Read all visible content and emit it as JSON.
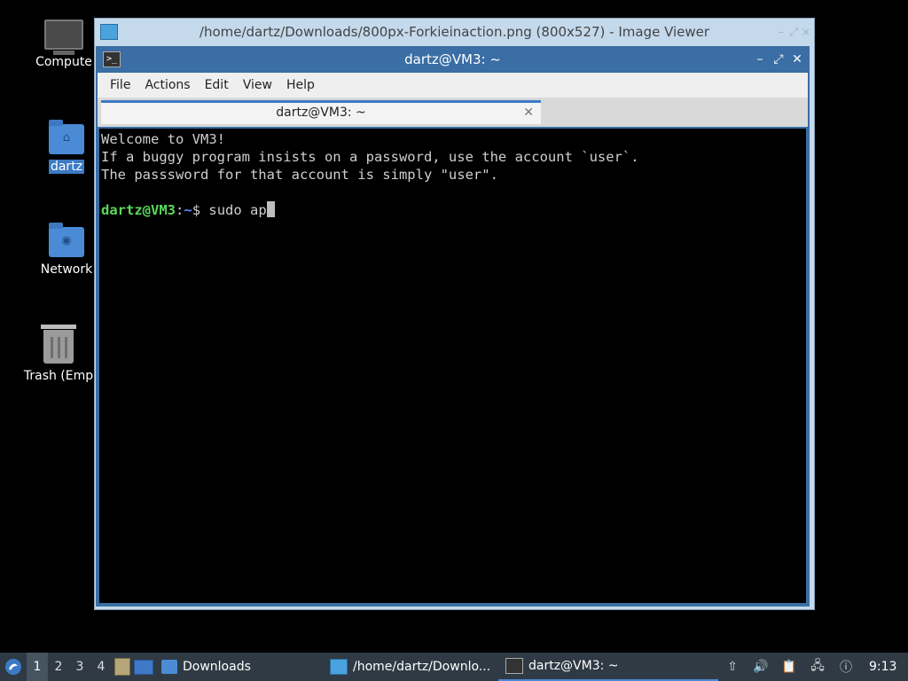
{
  "desktop": {
    "icons": [
      {
        "label": "Compute",
        "icon": "computer-icon"
      },
      {
        "label": "dartz",
        "icon": "home-folder-icon"
      },
      {
        "label": "Network",
        "icon": "network-folder-icon"
      },
      {
        "label": "Trash (Emp",
        "icon": "trash-icon"
      }
    ]
  },
  "viewer": {
    "title": "/home/dartz/Downloads/800px-Forkieinaction.png (800x527) - Image Viewer"
  },
  "terminal": {
    "title": "dartz@VM3: ~",
    "menu": [
      "File",
      "Actions",
      "Edit",
      "View",
      "Help"
    ],
    "tab_label": "dartz@VM3: ~",
    "lines": [
      "Welcome to VM3!",
      "If a buggy program insists on a password, use the account `user`.",
      "The passsword for that account is simply \"user\"."
    ],
    "prompt_user": "dartz@VM3",
    "prompt_sep": ":",
    "prompt_path": "~",
    "prompt_symbol": "$ ",
    "command": "sudo ap"
  },
  "taskbar": {
    "workspaces": [
      "1",
      "2",
      "3",
      "4"
    ],
    "active_workspace": "1",
    "tasks": [
      {
        "label": "Downloads",
        "icon": "folder-icon"
      },
      {
        "label": "/home/dartz/Downlo...",
        "icon": "image-viewer-icon"
      },
      {
        "label": "dartz@VM3: ~",
        "icon": "terminal-icon"
      }
    ],
    "clock": "9:13"
  },
  "colors": {
    "selection": "#3d7ac5",
    "prompt_user": "#5bd75b",
    "prompt_path": "#5f8bff",
    "taskbar": "#2f3a44"
  }
}
